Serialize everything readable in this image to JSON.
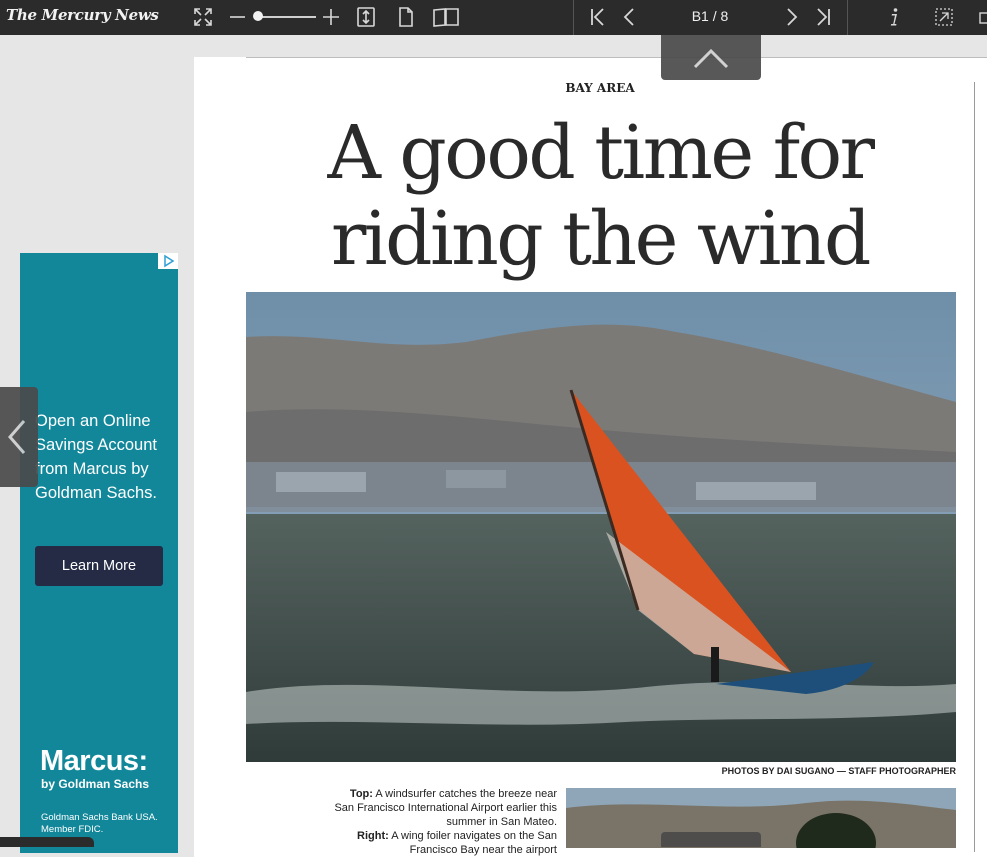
{
  "toolbar": {
    "logo": "The Mercury News",
    "page_indicator": "B1 / 8",
    "icons": [
      "fullscreen-icon",
      "zoom-out-icon",
      "zoom-slider",
      "zoom-in-icon",
      "fit-height-icon",
      "single-page-icon",
      "double-page-icon",
      "first-page-icon",
      "prev-page-icon",
      "next-page-icon",
      "last-page-icon",
      "info-icon",
      "clip-icon"
    ]
  },
  "ad": {
    "text": "Open an Online Savings Account from Marcus by Goldman Sachs.",
    "button": "Learn More",
    "brand": "Marcus:",
    "brand_sub": "by Goldman Sachs",
    "fine_print": "Goldman Sachs Bank USA. Member FDIC."
  },
  "article": {
    "section": "BAY AREA",
    "headline_line1": "A good time for",
    "headline_line2": "riding the wind",
    "credit": "PHOTOS BY DAI SUGANO — STAFF PHOTOGRAPHER",
    "caption_top_label": "Top:",
    "caption_top": "A windsurfer catches the breeze near San Francisco International Airport earlier this summer in San Mateo.",
    "caption_right_label": "Right:",
    "caption_right": "A wing foiler navigates on the San Francisco Bay near the airport"
  },
  "colors": {
    "toolbar_bg": "#2b2b2b",
    "ad_bg": "#12879a",
    "ad_button": "#252a45",
    "sail": "#d9521f"
  }
}
